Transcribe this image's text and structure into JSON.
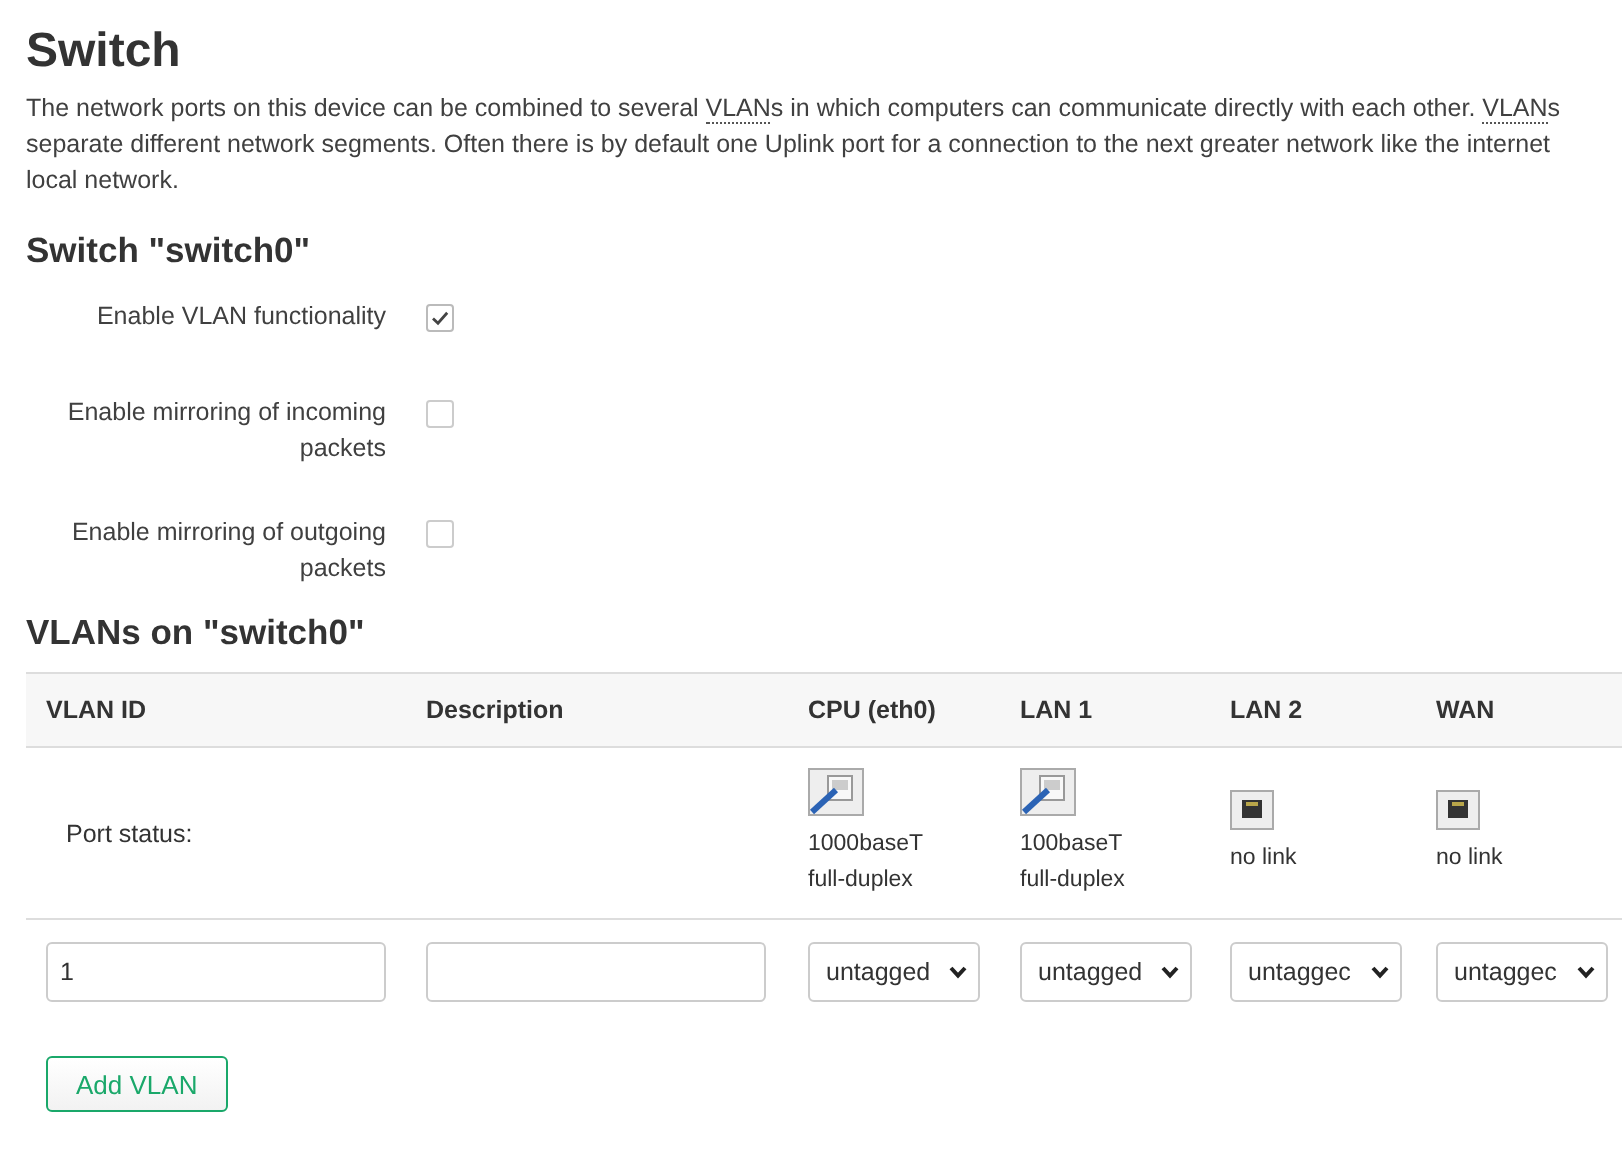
{
  "title": "Switch",
  "description": {
    "lines": [
      [
        {
          "text": "The network ports on this device can be combined to several "
        },
        {
          "abbr": "VLAN"
        },
        {
          "text": "s in which computers can communicate directly with each other. "
        },
        {
          "abbr": "VLAN"
        },
        {
          "text": "s"
        }
      ],
      [
        {
          "text": "separate different network segments. Often there is by default one Uplink port for a connection to the next greater network like the internet"
        }
      ],
      [
        {
          "text": "local network."
        }
      ]
    ]
  },
  "switch_section": {
    "title": "Switch \"switch0\"",
    "options": [
      {
        "label": "Enable VLAN functionality",
        "checked": true
      },
      {
        "label": "Enable mirroring of incoming packets",
        "checked": false
      },
      {
        "label": "Enable mirroring of outgoing packets",
        "checked": false
      }
    ]
  },
  "vlan_section": {
    "title": "VLANs on \"switch0\"",
    "columns": [
      "VLAN ID",
      "Description",
      "CPU (eth0)",
      "LAN 1",
      "LAN 2",
      "WAN"
    ],
    "status_label": "Port status:",
    "ports": [
      {
        "kind": "linked",
        "lines": [
          "1000baseT",
          "full-duplex"
        ]
      },
      {
        "kind": "linked",
        "lines": [
          "100baseT",
          "full-duplex"
        ]
      },
      {
        "kind": "nolink",
        "lines": [
          "no link"
        ]
      },
      {
        "kind": "nolink",
        "lines": [
          "no link"
        ]
      }
    ],
    "rows": [
      {
        "vlan_id": "1",
        "description": "",
        "ports": [
          "untagged",
          "untagged",
          "untaggec",
          "untaggec"
        ]
      }
    ],
    "add_button": "Add VLAN"
  }
}
